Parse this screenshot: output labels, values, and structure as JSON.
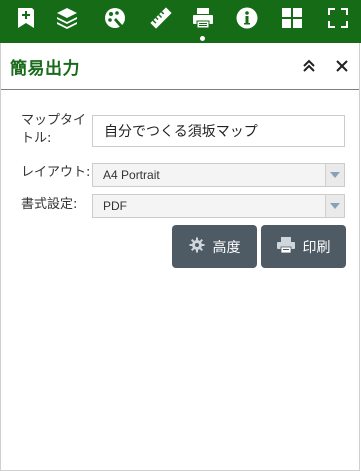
{
  "toolbar": {
    "items": [
      {
        "icon": "add-data-icon"
      },
      {
        "icon": "layers-icon"
      },
      {
        "icon": "basemap-gallery-icon"
      },
      {
        "icon": "measure-ruler-icon"
      },
      {
        "icon": "print-icon",
        "active": true
      },
      {
        "icon": "info-icon"
      },
      {
        "icon": "grid-apps-icon"
      },
      {
        "icon": "fullscreen-icon"
      }
    ]
  },
  "panel": {
    "title": "簡易出力",
    "form": {
      "map_title_label": "マップタイトル:",
      "map_title_value": "自分でつくる須坂マップ",
      "layout_label": "レイアウト:",
      "layout_value": "A4 Portrait",
      "format_label": "書式設定:",
      "format_value": "PDF"
    },
    "buttons": {
      "advanced_label": "高度",
      "print_label": "印刷"
    }
  },
  "colors": {
    "toolbar_bg": "#166b17",
    "title_color": "#1a6a1c",
    "button_bg": "#4e5a64"
  }
}
